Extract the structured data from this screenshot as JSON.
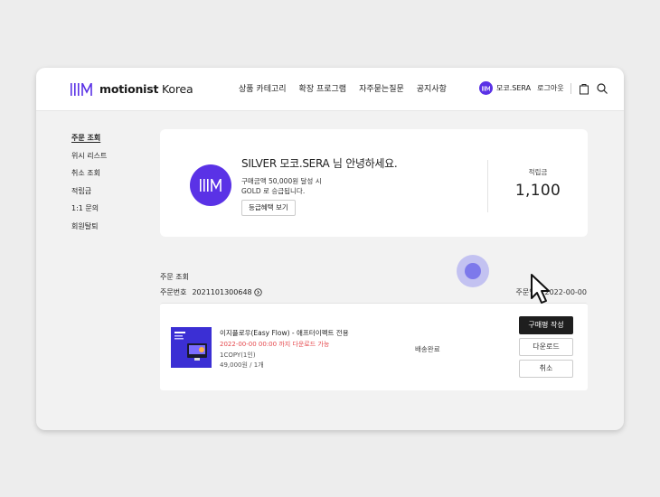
{
  "header": {
    "brand_strong": "motionist",
    "brand_light": " Korea",
    "nav": [
      "상품 카테고리",
      "확장 프로그램",
      "자주묻는질문",
      "공지사항"
    ],
    "user_name": "모코.SERA",
    "logout_label": "로그아웃"
  },
  "sidebar": {
    "items": [
      "주문 조회",
      "위시 리스트",
      "취소 조회",
      "적립금",
      "1:1 문의",
      "회원탈퇴"
    ]
  },
  "profile": {
    "greeting": "SILVER 모코.SERA 님 안녕하세요.",
    "grade_line1": "구매금액 50,000원 달성 시",
    "grade_line2": "GOLD 로 승급됩니다.",
    "benefit_button": "등급혜택 보기",
    "points_label": "적립금",
    "points_value": "1,100"
  },
  "orders": {
    "title": "주문 조회",
    "order_no_label": "주문번호",
    "order_no": "2021101300648",
    "order_date": "주문일자 2022-00-00",
    "item": {
      "name": "이지플로우(Easy Flow) - 애프터이펙트 전용",
      "download_notice": "2022-00-00 00:00 까지 다운로드 가능",
      "option": "1COPY(1인)",
      "price": "49,000원 / 1개",
      "status": "배송완료",
      "review_button": "구매평 작성",
      "download_button": "다운로드",
      "cancel_button": "취소"
    }
  },
  "colors": {
    "brand": "#5a32e6",
    "alert": "#e5484d"
  }
}
